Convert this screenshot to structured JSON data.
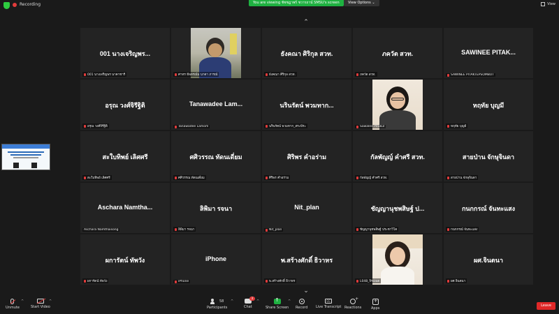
{
  "topbar": {
    "recording_label": "Recording",
    "viewing_notice": "You are viewing ชัชชฎาพร์ ชวารถาน์ SMSU's screen",
    "view_options_label": "View Options",
    "view_label": "View"
  },
  "tiles": [
    {
      "big": "001 นางเจริญพร...",
      "name": "001 นางเจริญพร นาคาชารี",
      "photo": ""
    },
    {
      "big": "",
      "name": "ศาทร ธีพทรณ์ม นาดา ภารณ์",
      "photo": "a"
    },
    {
      "big": "ธังคณา ศิริกุล สวท.",
      "name": "ธังคณา ศิริกุล สวท.",
      "photo": ""
    },
    {
      "big": "ภควัต สวท.",
      "name": "ภควัต สวท.",
      "photo": ""
    },
    {
      "big": "SAWINEE PITAK...",
      "name": "SAWINEE PITAKTEPSOMBUT",
      "photo": ""
    },
    {
      "big": "อรุณ วงศ์จิรีฐิติ",
      "name": "อรุณ วงศ์จิรีฐิติ",
      "photo": ""
    },
    {
      "big": "Tanawadee Lam...",
      "name": "Tanawadee Lamom",
      "photo": ""
    },
    {
      "big": "นรินรัตน์ พวมทาก...",
      "name": "นรินรัตน์ พวมทาก_สระนีระ",
      "photo": ""
    },
    {
      "big": "",
      "name": "Sawalee Pitakul",
      "photo": "b"
    },
    {
      "big": "หฤทัย บุญมี",
      "name": "หฤทัย บุญมี",
      "photo": ""
    },
    {
      "big": "สะใบทิพย์ เลิศศรี",
      "name": "สะใบทิพย์ เลิศศรี",
      "photo": ""
    },
    {
      "big": "ศศิวรรณ ทัดนเดี่ยม",
      "name": "ศศิวรรณ ทัดนเดี่ยม",
      "photo": ""
    },
    {
      "big": "ศิริพร คำอร่าม",
      "name": "ศิริพร คำอร่าม",
      "photo": ""
    },
    {
      "big": "กัลพัญญ์ คำศรี สวท.",
      "name": "กัลพัญญ์ คำศรี สวท.",
      "photo": ""
    },
    {
      "big": "สายป่าน จักษุจินดา",
      "name": "สายป่าน จักษุจินดา",
      "photo": ""
    },
    {
      "big": "Aschara Namtha...",
      "name": "Aschara Namthaisong",
      "photo": ""
    },
    {
      "big": "ลิพิมา รจนา",
      "name": "ลิพิมา รจนา",
      "photo": ""
    },
    {
      "big": "Nit_plan",
      "name": "Nit_plan",
      "photo": ""
    },
    {
      "big": "ชัญญานุชพสิษฐ์ ป...",
      "name": "ชัญญานุชพสิษฐ์ ประชาวิโค",
      "photo": ""
    },
    {
      "big": "กนกกรณ์ จันทะแสง",
      "name": "กนกกรณ์ จันทะแสง",
      "photo": ""
    },
    {
      "big": "ผการัตน์ ทัพวัง",
      "name": "ผการัตน์ ทัพวัง",
      "photo": ""
    },
    {
      "big": "iPhone",
      "name": "iPhone",
      "photo": ""
    },
    {
      "big": "พ.สร้างศักดิ์ ธิวาหร",
      "name": "พ.สร้างศักดิ์ ธิวาหร",
      "photo": ""
    },
    {
      "big": "",
      "name": "L048_จิรปณต",
      "photo": "c"
    },
    {
      "big": "ผศ.จินตนา",
      "name": "ผศ.จินตนา",
      "photo": ""
    }
  ],
  "toolbar": {
    "unmute": "Unmute",
    "start_video": "Start Video",
    "participants": "Participants",
    "participants_count": "58",
    "chat": "Chat",
    "chat_badge": "3",
    "share_screen": "Share Screen",
    "record": "Record",
    "live_transcript": "Live Transcript",
    "reactions": "Reactions",
    "apps": "Apps",
    "leave": "Leave"
  },
  "colors": {
    "accent_green": "#1fb141",
    "leave_red": "#e02828",
    "tile_bg": "#232323"
  }
}
